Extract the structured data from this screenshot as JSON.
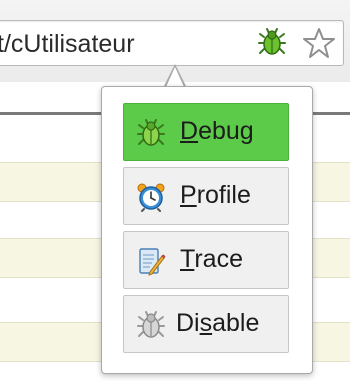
{
  "addressbar": {
    "url": "t/cUtilisateur"
  },
  "icons": {
    "url_extension": "bug-icon",
    "bookmark": "star-icon"
  },
  "popup": {
    "items": [
      {
        "label_pre": "",
        "label_key": "D",
        "label_post": "ebug",
        "icon": "bug-icon",
        "active": true
      },
      {
        "label_pre": "",
        "label_key": "P",
        "label_post": "rofile",
        "icon": "alarm-clock-icon",
        "active": false
      },
      {
        "label_pre": "",
        "label_key": "T",
        "label_post": "race",
        "icon": "notepad-icon",
        "active": false
      },
      {
        "label_pre": "Di",
        "label_key": "s",
        "label_post": "able",
        "icon": "gray-bug-icon",
        "active": false
      }
    ]
  },
  "colors": {
    "active_button": "#5ccb4a",
    "button": "#f0f0f0",
    "row_stripe": "#f6f6e2"
  }
}
